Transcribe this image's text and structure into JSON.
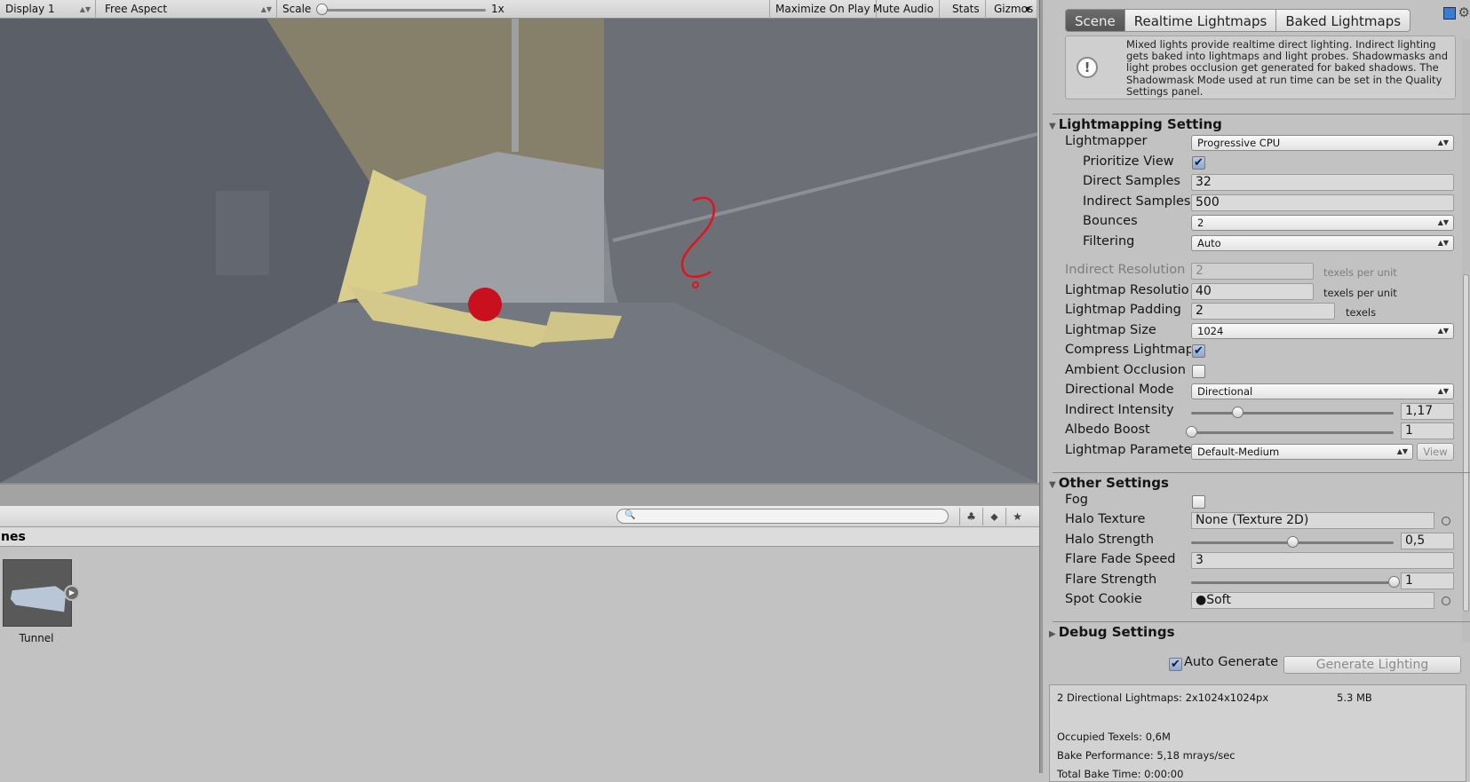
{
  "game_toolbar": {
    "display": "Display 1",
    "aspect": "Free Aspect",
    "scale_label": "Scale",
    "scale_value": "1x",
    "maximize_on_play": "Maximize On Play",
    "mute_audio": "Mute Audio",
    "stats": "Stats",
    "gizmos": "Gizmos"
  },
  "project": {
    "search_placeholder": "",
    "breadcrumb": "nes",
    "assets": [
      {
        "name": "Tunnel"
      }
    ]
  },
  "lighting": {
    "tabs": [
      {
        "label": "Scene",
        "active": true
      },
      {
        "label": "Realtime Lightmaps",
        "active": false
      },
      {
        "label": "Baked Lightmaps",
        "active": false
      }
    ],
    "help_text": "Mixed lights provide realtime direct lighting. Indirect lighting gets baked into lightmaps and light probes. Shadowmasks and light probes occlusion get generated for baked shadows. The Shadowmask Mode used at run time can be set in the Quality Settings panel.",
    "lightmapping": {
      "title": "Lightmapping Setting",
      "lightmapper_label": "Lightmapper",
      "lightmapper": "Progressive CPU",
      "prioritize_view_label": "Prioritize View",
      "prioritize_view": true,
      "direct_samples_label": "Direct Samples",
      "direct_samples": "32",
      "indirect_samples_label": "Indirect Samples",
      "indirect_samples": "500",
      "bounces_label": "Bounces",
      "bounces": "2",
      "filtering_label": "Filtering",
      "filtering": "Auto",
      "indirect_resolution_label": "Indirect Resolution",
      "indirect_resolution": "2",
      "texels_per_unit": "texels per unit",
      "lightmap_resolution_label": "Lightmap Resolutior",
      "lightmap_resolution": "40",
      "lightmap_padding_label": "Lightmap Padding",
      "lightmap_padding": "2",
      "texels": "texels",
      "lightmap_size_label": "Lightmap Size",
      "lightmap_size": "1024",
      "compress_label": "Compress Lightmap",
      "compress": true,
      "ao_label": "Ambient Occlusion",
      "ao": false,
      "directional_mode_label": "Directional Mode",
      "directional_mode": "Directional",
      "indirect_intensity_label": "Indirect Intensity",
      "indirect_intensity": "1,17",
      "indirect_intensity_fraction": 0.23,
      "albedo_boost_label": "Albedo Boost",
      "albedo_boost": "1",
      "albedo_boost_fraction": 0.0,
      "lightmap_parameters_label": "Lightmap Parameter",
      "lightmap_parameters": "Default-Medium",
      "view_button": "View"
    },
    "other": {
      "title": "Other Settings",
      "fog_label": "Fog",
      "fog": false,
      "halo_texture_label": "Halo Texture",
      "halo_texture": "None (Texture 2D)",
      "halo_strength_label": "Halo Strength",
      "halo_strength": "0,5",
      "halo_strength_fraction": 0.5,
      "flare_fade_speed_label": "Flare Fade Speed",
      "flare_fade_speed": "3",
      "flare_strength_label": "Flare Strength",
      "flare_strength": "1",
      "flare_strength_fraction": 1.0,
      "spot_cookie_label": "Spot Cookie",
      "spot_cookie": "Soft"
    },
    "debug": {
      "title": "Debug Settings"
    },
    "auto_generate_label": "Auto Generate",
    "auto_generate": true,
    "generate_button": "Generate Lighting",
    "stats": {
      "lightmaps": "2 Directional Lightmaps: 2x1024x1024px",
      "size": "5.3 MB",
      "occupied": "Occupied Texels: 0,6M",
      "performance": "Bake Performance: 5,18 mrays/sec",
      "total_bake_time": "Total Bake Time: 0:00:00"
    }
  },
  "colors": {
    "sphere": "#c8101e",
    "annotation": "#e0141e",
    "active_tab": "#5c5c5c"
  }
}
